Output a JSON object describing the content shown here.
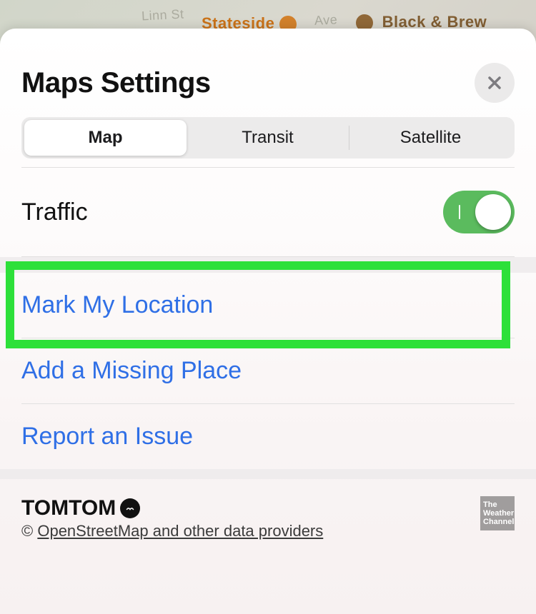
{
  "background": {
    "streets": [
      "Linn St",
      "Ave"
    ],
    "pois": [
      {
        "label": "Stateside",
        "color": "orange"
      },
      {
        "label": "Black & Brew",
        "color": "brown"
      }
    ]
  },
  "header": {
    "title": "Maps Settings",
    "close_icon": "close-icon"
  },
  "segmented": {
    "items": [
      "Map",
      "Transit",
      "Satellite"
    ],
    "selected_index": 0
  },
  "traffic": {
    "label": "Traffic",
    "on": true
  },
  "actions": {
    "mark_location": "Mark My Location",
    "add_place": "Add a Missing Place",
    "report_issue": "Report an Issue"
  },
  "highlight_target": "mark-location-row",
  "footer": {
    "provider_logo": "TOMTOM",
    "copyright_symbol": "©",
    "providers_link": "OpenStreetMap and other data providers",
    "twc_lines": [
      "The",
      "Weather",
      "Channel"
    ]
  },
  "colors": {
    "link": "#2f6fe6",
    "switch_on": "#5bbb5e",
    "highlight": "#2de03a"
  }
}
